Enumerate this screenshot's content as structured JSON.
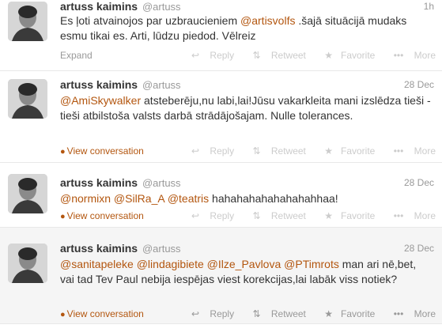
{
  "tweets": [
    {
      "name": "artuss kaimins",
      "handle": "@artuss",
      "time": "1h",
      "segments": [
        {
          "t": "Es ļoti atvainojos par uzbraucieniem "
        },
        {
          "t": "@artisvolfs",
          "m": true
        },
        {
          "t": " .šajā situācijā mudaks esmu tikai es. Arti, lūdzu piedod. Vēlreiz"
        }
      ],
      "left_action": "Expand"
    },
    {
      "name": "artuss kaimins",
      "handle": "@artuss",
      "time": "28 Dec",
      "segments": [
        {
          "t": "@AmiSkywalker",
          "m": true
        },
        {
          "t": " atsteberēju,nu labi,lai!Jūsu vakarkleita mani izslēdza tieši - tieši atbilstoša valsts darbā strādājošajam. Nulle tolerances."
        }
      ],
      "left_action": "View conversation"
    },
    {
      "name": "artuss kaimins",
      "handle": "@artuss",
      "time": "28 Dec",
      "segments": [
        {
          "t": "@normixn",
          "m": true
        },
        {
          "t": " "
        },
        {
          "t": "@SilRa_A",
          "m": true
        },
        {
          "t": " "
        },
        {
          "t": "@teatris",
          "m": true
        },
        {
          "t": " hahahahahahahahahhaa!"
        }
      ],
      "left_action": "View conversation"
    },
    {
      "name": "artuss kaimins",
      "handle": "@artuss",
      "time": "28 Dec",
      "segments": [
        {
          "t": "@sanitapeleke",
          "m": true
        },
        {
          "t": " "
        },
        {
          "t": "@lindagibiete",
          "m": true
        },
        {
          "t": " "
        },
        {
          "t": "@Ilze_Pavlova",
          "m": true
        },
        {
          "t": " "
        },
        {
          "t": "@PTimrots",
          "m": true
        },
        {
          "t": " man ari nē,bet, vai tad Tev Paul nebija iespējas viest korekcijas,lai labāk viss notiek?"
        }
      ],
      "left_action": "View conversation"
    }
  ],
  "actions": {
    "reply": "Reply",
    "retweet": "Retweet",
    "favorite": "Favorite",
    "more": "More"
  },
  "colors": {
    "link": "#b3560f",
    "muted": "#999999"
  }
}
